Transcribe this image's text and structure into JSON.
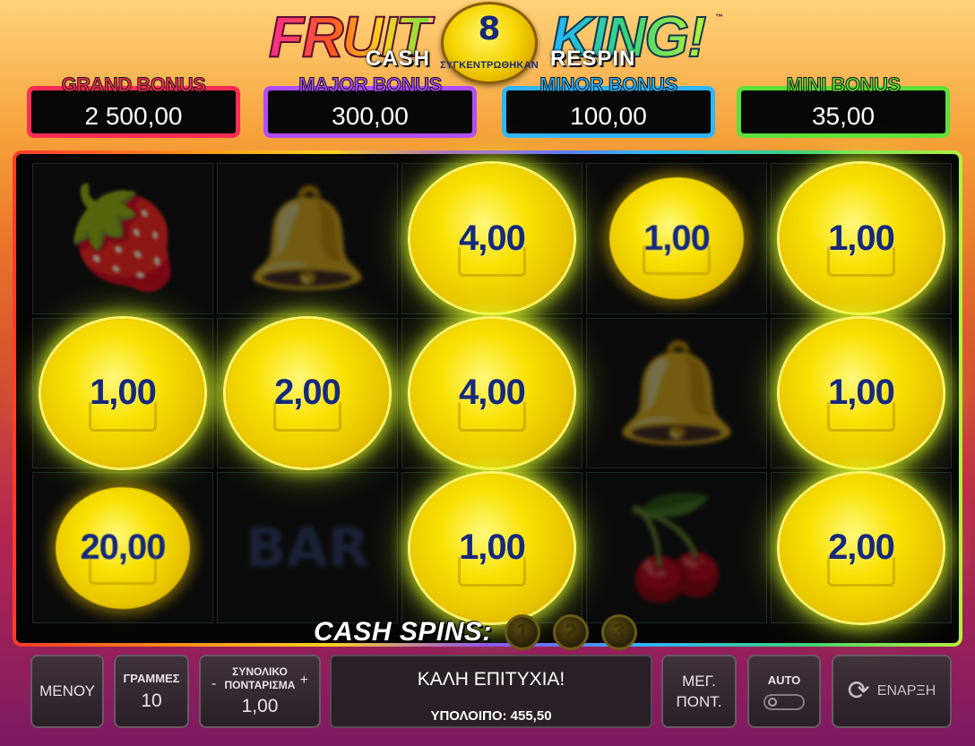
{
  "logo": {
    "fruit": "FRUIT",
    "cash": "CASH",
    "king": "KING!",
    "respin": "RESPIN",
    "tm": "™",
    "collected_count": "8",
    "collected_label": "ΣΥΓΚΕΝΤΡΩΘΗΚΑΝ"
  },
  "jackpots": [
    {
      "label": "GRAND BONUS",
      "value": "2 500,00",
      "color": "#ff2d55"
    },
    {
      "label": "MAJOR BONUS",
      "value": "300,00",
      "color": "#b04dff"
    },
    {
      "label": "MINOR BONUS",
      "value": "100,00",
      "color": "#2fb6ff"
    },
    {
      "label": "MINI BONUS",
      "value": "35,00",
      "color": "#5ee03a"
    }
  ],
  "reels": {
    "rows": [
      [
        {
          "type": "symbol",
          "icon": "strawberry-icon"
        },
        {
          "type": "symbol",
          "icon": "bell-icon"
        },
        {
          "type": "coin",
          "value": "4,00"
        },
        {
          "type": "coin",
          "value": "1,00",
          "state": "dim"
        },
        {
          "type": "coin",
          "value": "1,00"
        }
      ],
      [
        {
          "type": "coin",
          "value": "1,00"
        },
        {
          "type": "coin",
          "value": "2,00"
        },
        {
          "type": "coin",
          "value": "4,00"
        },
        {
          "type": "symbol",
          "icon": "bell-icon"
        },
        {
          "type": "coin",
          "value": "1,00"
        }
      ],
      [
        {
          "type": "coin",
          "value": "20,00",
          "state": "dim"
        },
        {
          "type": "symbol",
          "icon": "bar-icon"
        },
        {
          "type": "coin",
          "value": "1,00"
        },
        {
          "type": "symbol",
          "icon": "cherries-icon"
        },
        {
          "type": "coin",
          "value": "2,00"
        }
      ]
    ]
  },
  "cash_spins": {
    "label": "CASH SPINS:",
    "counters": [
      "1",
      "2",
      "3"
    ]
  },
  "panel": {
    "menu": "ΜΕΝΟΥ",
    "lines_label": "ΓΡΑΜΜΕΣ",
    "lines_value": "10",
    "total_bet_label_1": "ΣΥΝΟΛΙΚΟ",
    "total_bet_label_2": "ΠΟΝΤΑΡΙΣΜΑ",
    "total_bet_value": "1,00",
    "minus": "-",
    "plus": "+",
    "message": "ΚΑΛΗ ΕΠΙΤΥΧΙΑ!",
    "balance": "ΥΠΟΛΟΙΠΟ: 455,50",
    "max_bet_1": "ΜΕΓ.",
    "max_bet_2": "ΠΟΝΤ.",
    "auto": "AUTO",
    "start": "ΕΝΑΡΞΗ"
  }
}
